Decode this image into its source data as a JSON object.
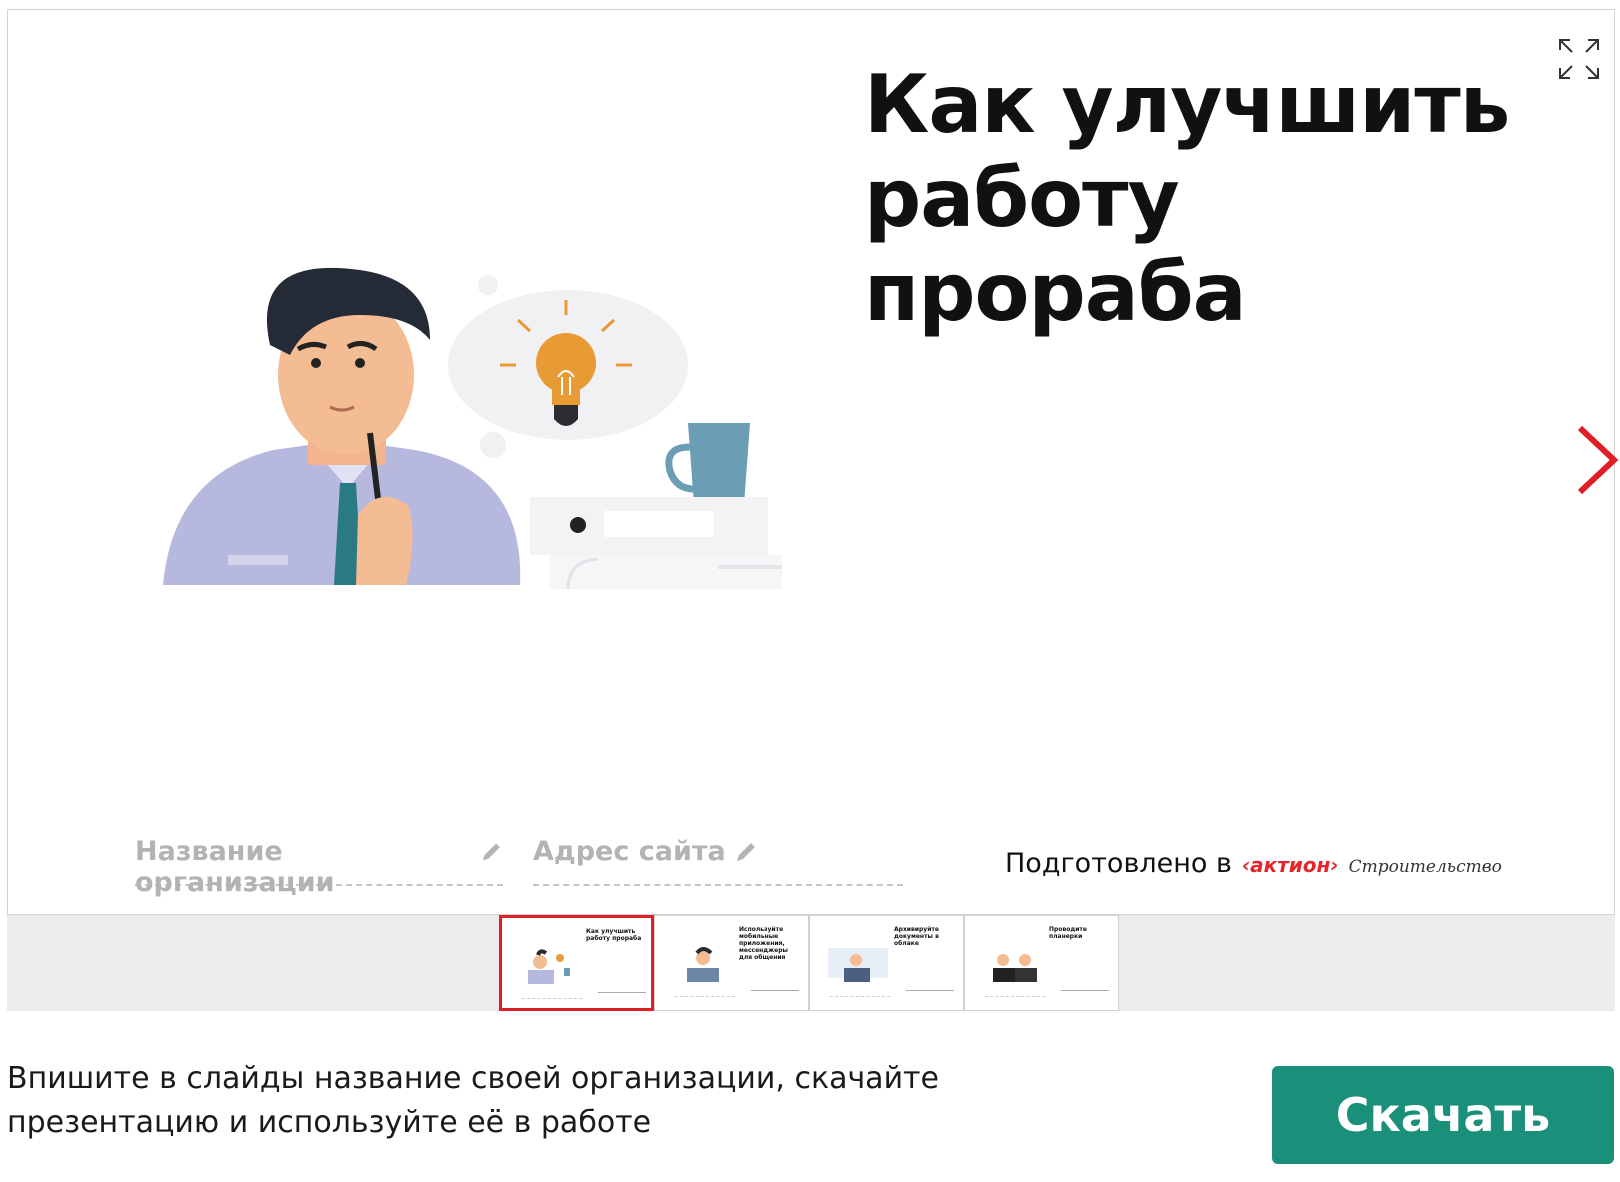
{
  "slide": {
    "title_line1": "Как улучшить",
    "title_line2": "работу прораба",
    "org_placeholder": "Название организации",
    "site_placeholder": "Адрес сайта",
    "prepared_label": "Подготовлено в",
    "brand_logo": "‹актион›",
    "brand_sub": "Строительство"
  },
  "icons": {
    "expand": "expand-icon",
    "next": "chevron-right-icon",
    "pencil": "pencil-icon"
  },
  "thumbnails": [
    {
      "title": "Как улучшить работу прораба",
      "active": true
    },
    {
      "title": "Используйте мобильные приложения, мессенджеры для общения",
      "active": false
    },
    {
      "title": "Архивируйте документы в облаке",
      "active": false
    },
    {
      "title": "Проводите планерки",
      "active": false
    }
  ],
  "footer": {
    "instruction_line1": "Впишите в слайды название своей организации, скачайте",
    "instruction_line2": "презентацию и используйте её в работе",
    "download_label": "Скачать"
  },
  "colors": {
    "accent_red": "#e01e25",
    "button_green": "#1a8f7a"
  }
}
